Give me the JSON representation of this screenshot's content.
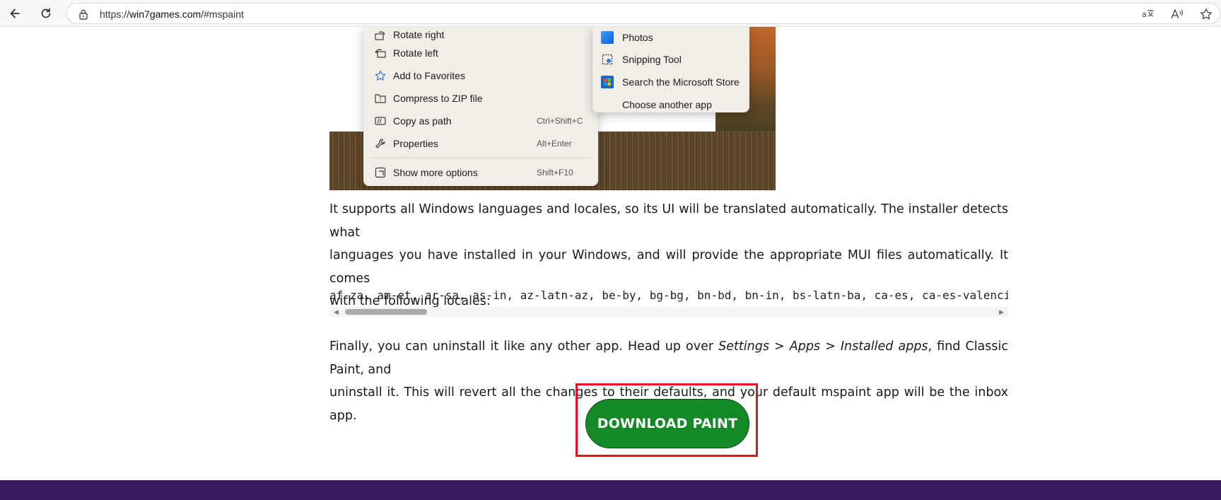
{
  "browser": {
    "url_prefix": "https://",
    "url_host": "win7games.com",
    "url_path": "/#mspaint"
  },
  "context_menu": {
    "items": [
      {
        "icon": "rotate-right-icon",
        "label": "Rotate right",
        "shortcut": ""
      },
      {
        "icon": "rotate-left-icon",
        "label": "Rotate left",
        "shortcut": ""
      },
      {
        "icon": "star-icon",
        "label": "Add to Favorites",
        "shortcut": ""
      },
      {
        "icon": "zip-icon",
        "label": "Compress to ZIP file",
        "shortcut": ""
      },
      {
        "icon": "copy-path-icon",
        "label": "Copy as path",
        "shortcut": "Ctrl+Shift+C"
      },
      {
        "icon": "wrench-icon",
        "label": "Properties",
        "shortcut": "Alt+Enter"
      },
      {
        "icon": "more-options-icon",
        "label": "Show more options",
        "shortcut": "Shift+F10"
      }
    ]
  },
  "open_with_menu": {
    "items": [
      {
        "icon": "photos-icon",
        "label": "Photos"
      },
      {
        "icon": "snipping-tool-icon",
        "label": "Snipping Tool"
      },
      {
        "icon": "microsoft-store-icon",
        "label": "Search the Microsoft Store"
      },
      {
        "icon": "",
        "label": "Choose another app"
      }
    ]
  },
  "article": {
    "para1_line1": "It supports all Windows languages and locales, so its UI will be translated automatically. The installer detects what",
    "para1_line2": "languages you have installed in your Windows, and will provide the appropriate MUI files automatically. It comes",
    "para1_line3": "with the following locales:",
    "locales": "af-za, am-et, ar-sa, as-in, az-latn-az, be-by, bg-bg, bn-bd, bn-in, bs-latn-ba, ca-es, ca-es-valencia, chr-",
    "para2_a": "Finally, you can uninstall it like any other app. Head up over ",
    "para2_em": "Settings > Apps > Installed apps",
    "para2_b": ", find Classic Paint, and",
    "para2_line2": "uninstall it. This will revert all the changes to their defaults, and your default mspaint app will be the inbox app."
  },
  "download_button": {
    "label": "DOWNLOAD PAINT"
  }
}
